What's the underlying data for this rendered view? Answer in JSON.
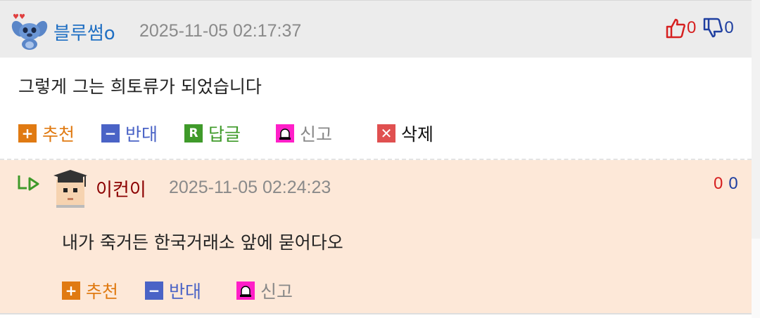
{
  "comments": [
    {
      "nickname": "블루썸o",
      "datetime": "2025-11-05 02:17:37",
      "text": "그렇게 그는 희토류가 되었습니다",
      "likes": "0",
      "dislikes": "0",
      "actions": {
        "recommend": "추천",
        "oppose": "반대",
        "reply": "답글",
        "report": "신고",
        "delete": "삭제"
      }
    },
    {
      "nickname": "이컨이",
      "datetime": "2025-11-05 02:24:23",
      "text": "내가 죽거든 한국거래소 앞에 묻어다오",
      "likes": "0",
      "dislikes": "0",
      "actions": {
        "recommend": "추천",
        "oppose": "반대",
        "report": "신고"
      }
    }
  ],
  "icons": {
    "c1_avatar": "stitch-avatar-icon",
    "c2_avatar": "graduate-avatar-icon",
    "reply_arrow": "reply-arrow-icon",
    "thumb_up": "thumbs-up-icon",
    "thumb_down": "thumbs-down-icon",
    "recommend": "plus-icon",
    "oppose": "minus-icon",
    "reply": "r-icon",
    "report": "siren-icon",
    "delete": "close-icon"
  },
  "colors": {
    "recommend": "#e07a12",
    "oppose": "#4a63c6",
    "reply": "#3f9a2a",
    "report": "#888888",
    "delete_icon": "#e05050",
    "like": "#d62020",
    "dislike": "#1f3fa0",
    "reply_bg": "#fde8d8"
  }
}
